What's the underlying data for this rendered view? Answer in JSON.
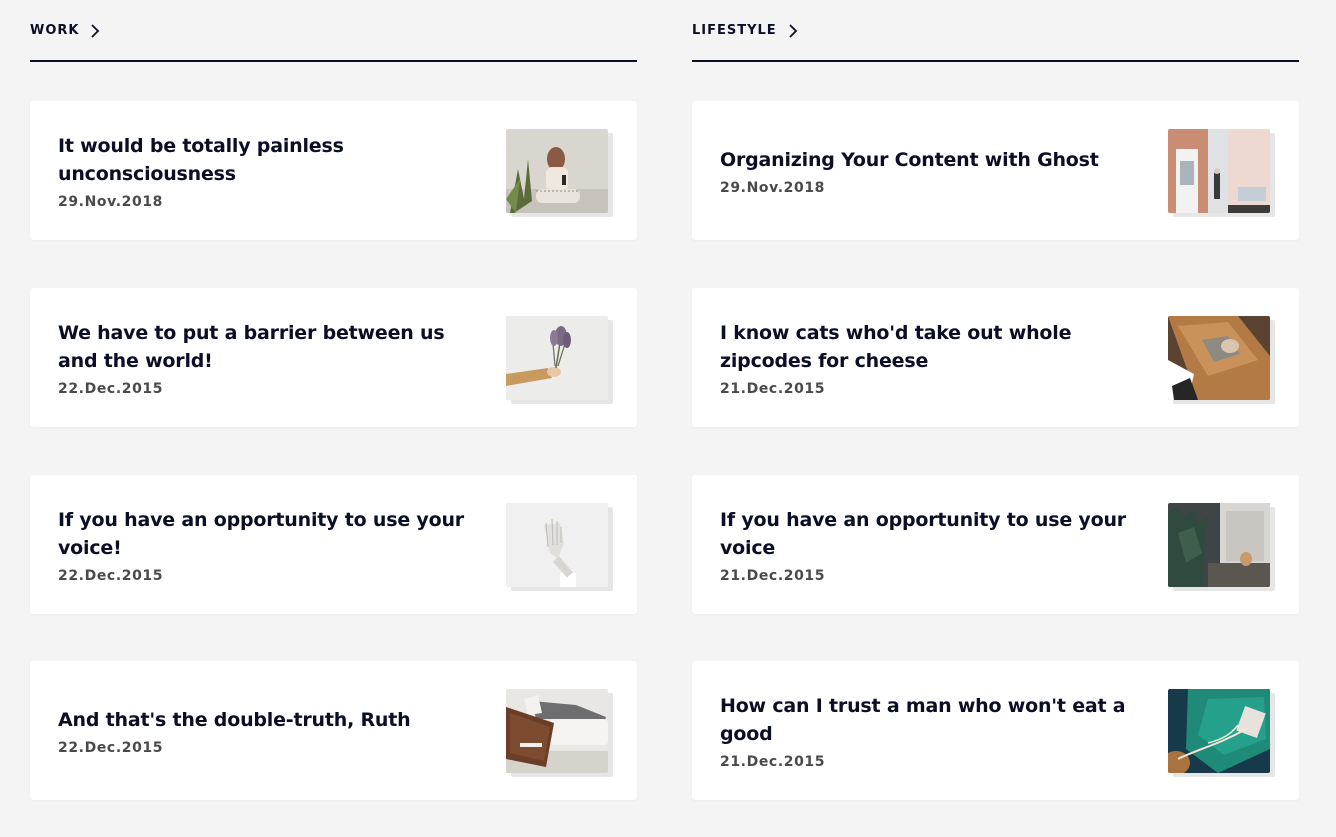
{
  "sections": [
    {
      "title": "WORK",
      "posts": [
        {
          "title": "It would be totally painless unconsciousness",
          "date": "29.Nov.2018"
        },
        {
          "title": "We have to put a barrier between us and the world!",
          "date": "22.Dec.2015"
        },
        {
          "title": "If you have an opportunity to use your voice!",
          "date": "22.Dec.2015"
        },
        {
          "title": "And that's the double-truth, Ruth",
          "date": "22.Dec.2015"
        }
      ]
    },
    {
      "title": "LIFESTYLE",
      "posts": [
        {
          "title": "Organizing Your Content with Ghost",
          "date": "29.Nov.2018"
        },
        {
          "title": "I know cats who'd take out whole zipcodes for cheese",
          "date": "21.Dec.2015"
        },
        {
          "title": "If you have an opportunity to use your voice",
          "date": "21.Dec.2015"
        },
        {
          "title": "How can I trust a man who won't eat a good",
          "date": "21.Dec.2015"
        }
      ]
    }
  ],
  "icons": {
    "section_link": "chevron-right-icon"
  }
}
